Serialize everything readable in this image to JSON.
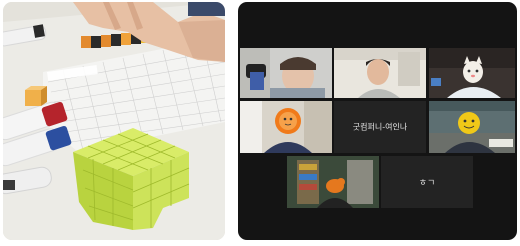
{
  "call": {
    "participants": [
      {
        "name": "",
        "kind": "video"
      },
      {
        "name": "",
        "kind": "video"
      },
      {
        "name": "",
        "kind": "video"
      },
      {
        "name": "",
        "kind": "video"
      },
      {
        "name": "굿컴퍼니-여인나",
        "kind": "name-only"
      },
      {
        "name": "",
        "kind": "video"
      },
      {
        "name": "",
        "kind": "video-active"
      },
      {
        "name": "ㅎㄱ",
        "kind": "name-only"
      }
    ],
    "accent_color": "#5ec04a"
  },
  "photo": {
    "subject": "counting-blocks-on-grid-board"
  }
}
